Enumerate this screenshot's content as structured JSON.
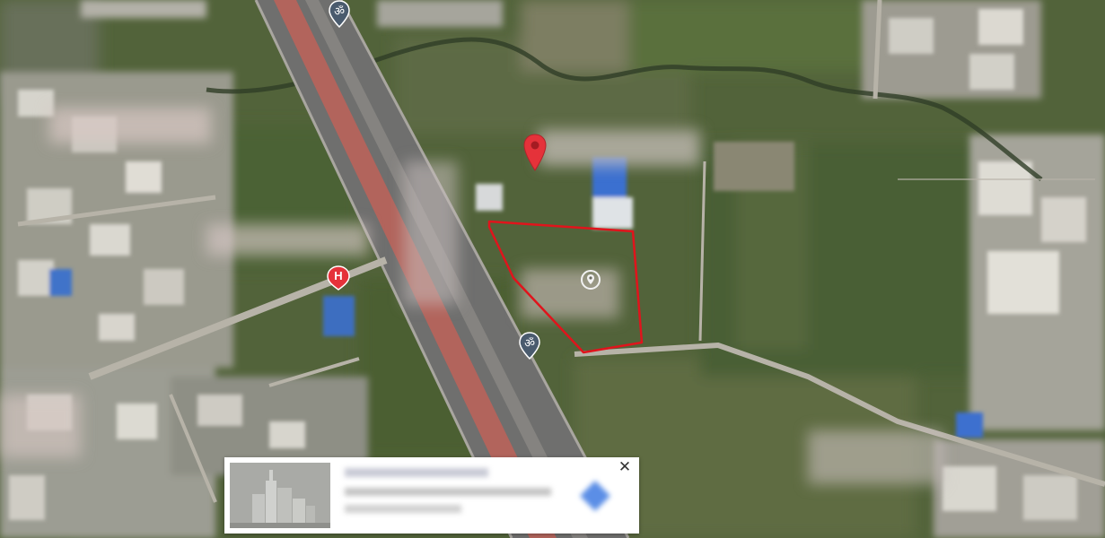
{
  "map": {
    "view": "satellite",
    "selected_parcel_outline_color": "#e0141c",
    "place_pin_color": "#e5323a",
    "hospital_marker_color": "#e5323a",
    "worship_marker_color": "#4a5b6e"
  },
  "markers": [
    {
      "name": "place-pin",
      "icon": "location-pin-icon"
    },
    {
      "name": "hospital",
      "icon": "hospital-h-icon",
      "glyph": "H"
    },
    {
      "name": "worship-top",
      "icon": "om-icon",
      "glyph": "ॐ"
    },
    {
      "name": "worship-mid",
      "icon": "om-icon",
      "glyph": "ॐ"
    },
    {
      "name": "parcel-center",
      "icon": "location-circle-icon"
    }
  ],
  "info_card": {
    "title": "",
    "lines": [
      "",
      ""
    ],
    "close_glyph": "✕",
    "thumbnail_icon": "building-thumbnail-icon",
    "directions_icon": "directions-icon"
  }
}
